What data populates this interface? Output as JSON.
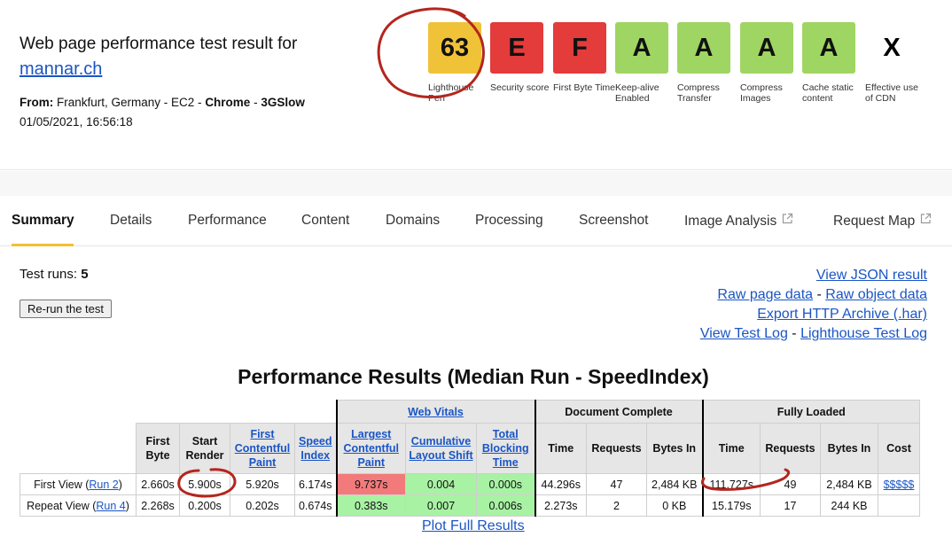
{
  "header": {
    "title": "Web page performance test result for",
    "site": "mannar.ch",
    "from_label": "From:",
    "location": "Frankfurt, Germany - EC2 - ",
    "browser": "Chrome",
    "separator": " - ",
    "connection": "3GSlow",
    "datetime": "01/05/2021, 16:56:18"
  },
  "grades": [
    {
      "value": "63",
      "label": "Lighthouse Perf",
      "color": "#f0c238"
    },
    {
      "value": "E",
      "label": "Security score",
      "color": "#e43b3b"
    },
    {
      "value": "F",
      "label": "First Byte Time",
      "color": "#e43b3b"
    },
    {
      "value": "A",
      "label": "Keep-alive Enabled",
      "color": "#9fd562"
    },
    {
      "value": "A",
      "label": "Compress Transfer",
      "color": "#9fd562"
    },
    {
      "value": "A",
      "label": "Compress Images",
      "color": "#9fd562"
    },
    {
      "value": "A",
      "label": "Cache static content",
      "color": "#9fd562"
    },
    {
      "value": "X",
      "label": "Effective use of CDN",
      "color": "transparent"
    }
  ],
  "tabs": [
    {
      "label": "Summary",
      "active": true
    },
    {
      "label": "Details"
    },
    {
      "label": "Performance"
    },
    {
      "label": "Content"
    },
    {
      "label": "Domains"
    },
    {
      "label": "Processing"
    },
    {
      "label": "Screenshot"
    },
    {
      "label": "Image Analysis",
      "external": true
    },
    {
      "label": "Request Map",
      "external": true
    }
  ],
  "test_runs_label": "Test runs:",
  "test_runs_count": "5",
  "rerun_button": "Re-run the test",
  "links": {
    "json": "View JSON result",
    "raw_page": "Raw page data",
    "raw_object": "Raw object data",
    "export_har": "Export HTTP Archive (.har)",
    "test_log": "View Test Log",
    "lighthouse_log": "Lighthouse Test Log",
    "dash": " - "
  },
  "results_title": "Performance Results (Median Run - SpeedIndex)",
  "table": {
    "groups": {
      "web_vitals": "Web Vitals",
      "document_complete": "Document Complete",
      "fully_loaded": "Fully Loaded"
    },
    "headers": {
      "first_byte": "First Byte",
      "start_render": "Start Render",
      "fcp": "First Contentful Paint",
      "speed_index": "Speed Index",
      "lcp": "Largest Contentful Paint",
      "cls": "Cumulative Layout Shift",
      "tbt": "Total Blocking Time",
      "dc_time": "Time",
      "dc_requests": "Requests",
      "dc_bytes": "Bytes In",
      "fl_time": "Time",
      "fl_requests": "Requests",
      "fl_bytes": "Bytes In",
      "cost": "Cost"
    },
    "rows": [
      {
        "label": "First View (",
        "run_link": "Run 2",
        "label_end": ")",
        "first_byte": "2.660s",
        "start_render": "5.900s",
        "fcp": "5.920s",
        "speed_index": "6.174s",
        "lcp": "9.737s",
        "cls": "0.004",
        "tbt": "0.000s",
        "dc_time": "44.296s",
        "dc_requests": "47",
        "dc_bytes": "2,484 KB",
        "fl_time": "111.727s",
        "fl_requests": "49",
        "fl_bytes": "2,484 KB",
        "cost": "$$$$$"
      },
      {
        "label": "Repeat View (",
        "run_link": "Run 4",
        "label_end": ")",
        "first_byte": "2.268s",
        "start_render": "0.200s",
        "fcp": "0.202s",
        "speed_index": "0.674s",
        "lcp": "0.383s",
        "cls": "0.007",
        "tbt": "0.006s",
        "dc_time": "2.273s",
        "dc_requests": "2",
        "dc_bytes": "0 KB",
        "fl_time": "15.179s",
        "fl_requests": "17",
        "fl_bytes": "244 KB",
        "cost": ""
      }
    ]
  },
  "plot_link": "Plot Full Results",
  "colors": {
    "link": "#1a55c4",
    "grade_yellow": "#f0c238",
    "grade_red": "#e43b3b",
    "grade_green": "#9fd562",
    "cell_red": "#f27a7a",
    "cell_green": "#a8f2a4",
    "tab_underline": "#f3c033",
    "annotation": "#c0392b"
  }
}
